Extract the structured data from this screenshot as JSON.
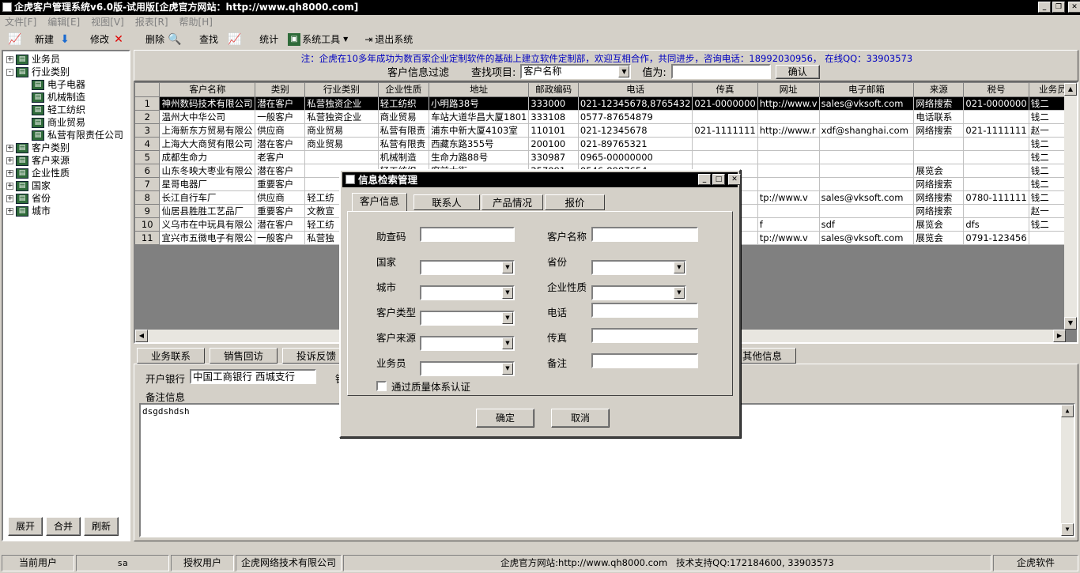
{
  "window": {
    "title": "企虎客户管理系统v6.0版-试用版[企虎官方网站：http://www.qh8000.com]"
  },
  "menu": [
    "文件[F]",
    "编辑[E]",
    "视图[V]",
    "报表[R]",
    "帮助[H]"
  ],
  "toolbar": {
    "new": "新建",
    "edit": "修改",
    "delete": "删除",
    "find": "查找",
    "stats": "统计",
    "tools": "系统工具",
    "exit": "退出系统"
  },
  "tree": {
    "nodes": [
      {
        "label": "业务员",
        "level": 0,
        "expander": "+"
      },
      {
        "label": "行业类别",
        "level": 0,
        "expander": "-"
      },
      {
        "label": "电子电器",
        "level": 1,
        "expander": ""
      },
      {
        "label": "机械制造",
        "level": 1,
        "expander": ""
      },
      {
        "label": "轻工纺织",
        "level": 1,
        "expander": ""
      },
      {
        "label": "商业贸易",
        "level": 1,
        "expander": ""
      },
      {
        "label": "私营有限责任公司",
        "level": 1,
        "expander": ""
      },
      {
        "label": "客户类别",
        "level": 0,
        "expander": "+"
      },
      {
        "label": "客户来源",
        "level": 0,
        "expander": "+"
      },
      {
        "label": "企业性质",
        "level": 0,
        "expander": "+"
      },
      {
        "label": "国家",
        "level": 0,
        "expander": "+"
      },
      {
        "label": "省份",
        "level": 0,
        "expander": "+"
      },
      {
        "label": "城市",
        "level": 0,
        "expander": "+"
      }
    ],
    "buttons": [
      "展开",
      "合并",
      "刷新"
    ]
  },
  "notice": "注：企虎在10多年成功为数百家企业定制软件的基础上建立软件定制部，欢迎互相合作，共同进步，咨询电话：18992030956， 在线QQ：33903573",
  "filter": {
    "title": "客户信息过滤",
    "field_label": "查找项目:",
    "field_value": "客户名称",
    "value_label": "值为:",
    "value": "",
    "confirm": "确认"
  },
  "grid": {
    "columns": [
      "客户名称",
      "类别",
      "行业类别",
      "企业性质",
      "地址",
      "邮政编码",
      "电话",
      "传真",
      "网址",
      "电子邮箱",
      "来源",
      "税号",
      "业务员"
    ],
    "rows": [
      [
        "1",
        "神州数码技术有限公司",
        "潜在客户",
        "私营独资企业",
        "轻工纺织",
        "小明路38号",
        "333000",
        "021-12345678,8765432",
        "021-0000000",
        "http://www.v",
        "sales@vksoft.com",
        "网络搜索",
        "021-0000000",
        "钱二"
      ],
      [
        "2",
        "温州大中华公司",
        "一般客户",
        "私营独资企业",
        "商业贸易",
        "车站大道华昌大厦1801",
        "333108",
        "0577-87654879",
        "",
        "",
        "",
        "电话联系",
        "",
        "钱二"
      ],
      [
        "3",
        "上海新东方贸易有限公",
        "供应商",
        "商业贸易",
        "私营有限责",
        "浦东中新大厦4103室",
        "110101",
        "021-12345678",
        "021-1111111",
        "http://www.r",
        "xdf@shanghai.com",
        "网络搜索",
        "021-1111111",
        "赵一"
      ],
      [
        "4",
        "上海大大商贸有限公司",
        "潜在客户",
        "商业贸易",
        "私营有限责",
        "西藏东路355号",
        "200100",
        "021-89765321",
        "",
        "",
        "",
        "",
        "",
        "钱二"
      ],
      [
        "5",
        "成都生命力",
        "老客户",
        "",
        "机械制造",
        "生命力路88号",
        "330987",
        "0965-00000000",
        "",
        "",
        "",
        "",
        "",
        "钱二"
      ],
      [
        "6",
        "山东冬映大枣业有限公",
        "潜在客户",
        "",
        "轻工纺织",
        "府前大街",
        "257091",
        "0546-8987654",
        "",
        "",
        "",
        "展览会",
        "",
        "钱二"
      ],
      [
        "7",
        "星哥电器厂",
        "重要客户",
        "",
        "",
        "",
        "",
        "",
        "",
        "",
        "",
        "网络搜索",
        "",
        "钱二"
      ],
      [
        "8",
        "长江自行车厂",
        "供应商",
        "轻工纺",
        "",
        "",
        "",
        "",
        "",
        "tp://www.v",
        "sales@vksoft.com",
        "网络搜索",
        "0780-111111",
        "钱二"
      ],
      [
        "9",
        "仙居县胜胜工艺品厂",
        "重要客户",
        "文教宣",
        "",
        "",
        "",
        "",
        "",
        "",
        "",
        "网络搜索",
        "",
        "赵一"
      ],
      [
        "10",
        "义乌市在中玩具有限公",
        "潜在客户",
        "轻工纺",
        "",
        "",
        "",
        "",
        "",
        "f",
        "sdf",
        "展览会",
        "dfs",
        "钱二"
      ],
      [
        "11",
        "宜兴市五微电子有限公",
        "一般客户",
        "私营独",
        "",
        "",
        "",
        "",
        "",
        "tp://www.v",
        "sales@vksoft.com",
        "展览会",
        "0791-123456",
        ""
      ]
    ]
  },
  "bottom_tabs": [
    "业务联系",
    "销售回访",
    "投诉反馈",
    "其他信息"
  ],
  "detail": {
    "bank_label": "开户银行",
    "bank_value": "中国工商银行 西城支行",
    "account_label_fragment": "银",
    "remarks_label": "备注信息",
    "remarks_value": "dsgdshdsh"
  },
  "status": {
    "current_user_label": "当前用户",
    "current_user": "sa",
    "licensed_label": "授权用户",
    "licensed_to": "企虎网络技术有限公司",
    "website": "企虎官方网站:http://www.qh8000.com",
    "support": "技术支持QQ:172184600, 33903573",
    "brand": "企虎软件"
  },
  "dialog": {
    "title": "信息检索管理",
    "tabs": [
      "客户信息",
      "联系人",
      "产品情况",
      "报价"
    ],
    "fields": [
      {
        "label": "助查码",
        "type": "input",
        "value": ""
      },
      {
        "label": "客户名称",
        "type": "input",
        "value": ""
      },
      {
        "label": "国家",
        "type": "combo",
        "value": ""
      },
      {
        "label": "省份",
        "type": "combo",
        "value": ""
      },
      {
        "label": "城市",
        "type": "combo",
        "value": ""
      },
      {
        "label": "企业性质",
        "type": "combo",
        "value": ""
      },
      {
        "label": "客户类型",
        "type": "combo",
        "value": ""
      },
      {
        "label": "电话",
        "type": "input",
        "value": ""
      },
      {
        "label": "客户来源",
        "type": "combo",
        "value": ""
      },
      {
        "label": "传真",
        "type": "input",
        "value": ""
      },
      {
        "label": "业务员",
        "type": "combo",
        "value": ""
      },
      {
        "label": "备注",
        "type": "input",
        "value": ""
      }
    ],
    "checkbox_label": "通过质量体系认证",
    "checkbox_checked": false,
    "ok": "确定",
    "cancel": "取消"
  },
  "colors": {
    "notice": "#0000c0",
    "titlebar": "#000000",
    "face": "#d4d0c8"
  }
}
